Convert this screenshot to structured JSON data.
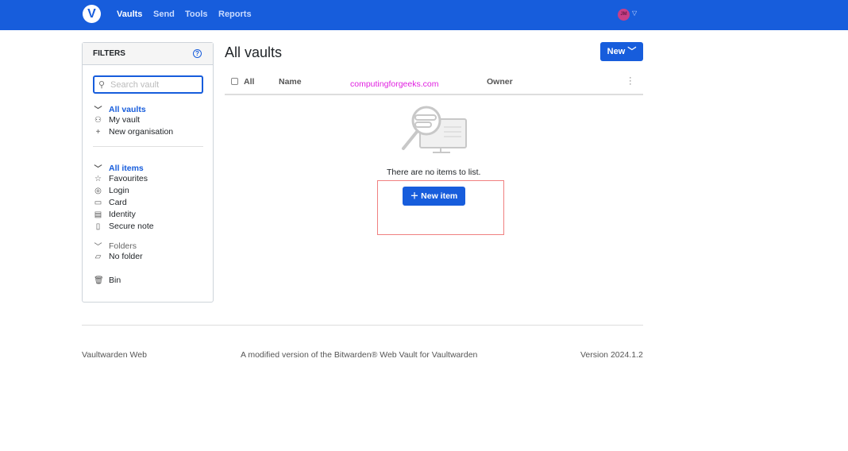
{
  "nav": {
    "logo": "V",
    "links": [
      "Vaults",
      "Send",
      "Tools",
      "Reports"
    ],
    "avatar": "JM"
  },
  "filters": {
    "title": "FILTERS",
    "search_placeholder": "Search vault",
    "vaults": {
      "header": "All vaults",
      "items": [
        "My vault",
        "New organisation"
      ]
    },
    "types": {
      "header": "All items",
      "items": [
        "Favourites",
        "Login",
        "Card",
        "Identity",
        "Secure note"
      ]
    },
    "folders": {
      "header": "Folders",
      "items": [
        "No folder"
      ]
    },
    "bin": "Bin"
  },
  "main": {
    "title": "All vaults",
    "new_button": "New",
    "columns": [
      "All",
      "Name",
      "Owner"
    ],
    "watermark": "computingforgeeks.com",
    "empty_text": "There are no items to list.",
    "new_item_button": "New item"
  },
  "footer": {
    "left": "Vaultwarden Web",
    "center": "A modified version of the Bitwarden® Web Vault for Vaultwarden",
    "right": "Version 2024.1.2"
  },
  "colors": {
    "brand": "#175ddc",
    "highlight_box": "#f08080",
    "watermark": "#e020e0"
  }
}
